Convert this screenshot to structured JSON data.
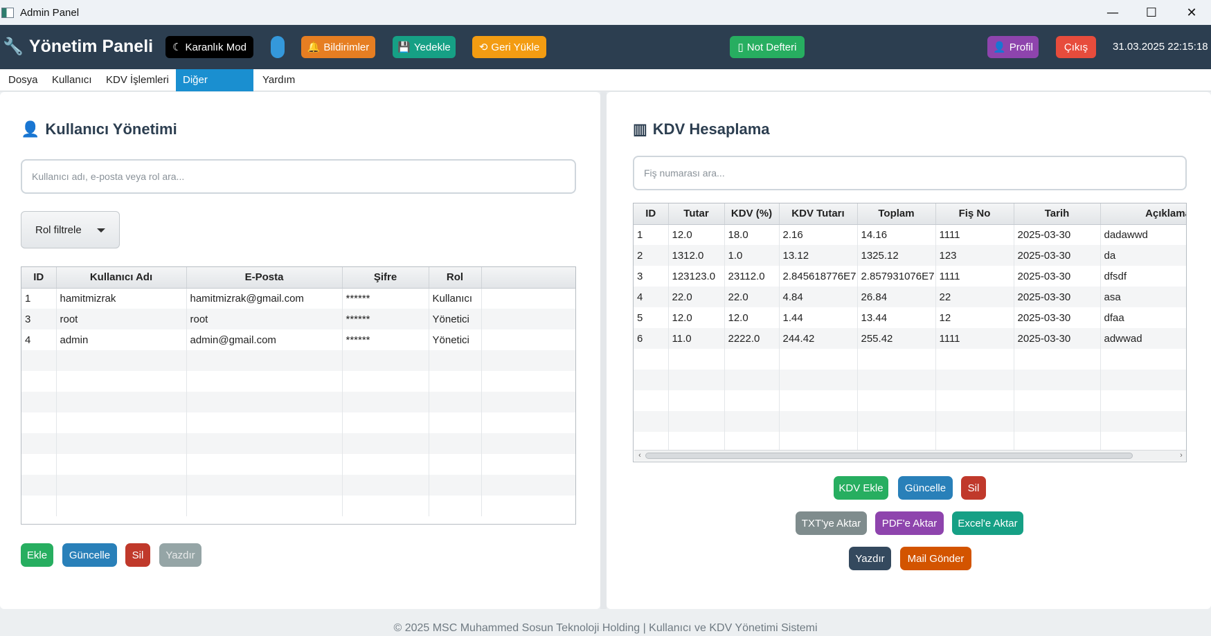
{
  "window": {
    "title": "Admin Panel",
    "controls": {
      "minimize": "—",
      "maximize": "☐",
      "close": "✕"
    }
  },
  "header": {
    "brand": "Yönetim Paneli",
    "buttons": {
      "dark_mode": "Karanlık Mod",
      "notifications": "Bildirimler",
      "backup": "Yedekle",
      "restore": "Geri Yükle",
      "notepad": "Not Defteri",
      "profile": "Profil",
      "logout": "Çıkış"
    },
    "datetime": "31.03.2025 22:15:18",
    "colors": {
      "background": "#2c3e50",
      "dark_mode": "#000000",
      "toggle": "#3498db",
      "notifications": "#e67e22",
      "backup": "#16a085",
      "restore": "#f39c12",
      "notepad": "#27ae60",
      "profile": "#8e44ad",
      "logout": "#e74c3c"
    }
  },
  "menu": {
    "items": [
      "Dosya",
      "Kullanıcı",
      "KDV İşlemleri",
      "Diğer İşlemler",
      "Yardım"
    ],
    "active": "Diğer İşlemler"
  },
  "users": {
    "title": "Kullanıcı Yönetimi",
    "search_placeholder": "Kullanıcı adı, e-posta veya rol ara...",
    "role_filter": "Rol filtrele",
    "columns": [
      "ID",
      "Kullanıcı Adı",
      "E-Posta",
      "Şifre",
      "Rol"
    ],
    "rows": [
      [
        "1",
        "hamitmizrak",
        "hamitmizrak@gmail.com",
        "******",
        "Kullanıcı"
      ],
      [
        "3",
        "root",
        "root",
        "******",
        "Yönetici"
      ],
      [
        "4",
        "admin",
        "admin@gmail.com",
        "******",
        "Yönetici"
      ]
    ],
    "buttons": {
      "add": "Ekle",
      "update": "Güncelle",
      "delete": "Sil",
      "print": "Yazdır"
    }
  },
  "kdv": {
    "title": "KDV Hesaplama",
    "search_placeholder": "Fiş numarası ara...",
    "columns": [
      "ID",
      "Tutar",
      "KDV (%)",
      "KDV Tutarı",
      "Toplam",
      "Fiş No",
      "Tarih",
      "Açıklama"
    ],
    "rows": [
      [
        "1",
        "12.0",
        "18.0",
        "2.16",
        "14.16",
        "1111",
        "2025-03-30",
        "dadawwd"
      ],
      [
        "2",
        "1312.0",
        "1.0",
        "13.12",
        "1325.12",
        "123",
        "2025-03-30",
        "da"
      ],
      [
        "3",
        "123123.0",
        "23112.0",
        "2.845618776E7",
        "2.857931076E7",
        "1111",
        "2025-03-30",
        "dfsdf"
      ],
      [
        "4",
        "22.0",
        "22.0",
        "4.84",
        "26.84",
        "22",
        "2025-03-30",
        "asa"
      ],
      [
        "5",
        "12.0",
        "12.0",
        "1.44",
        "13.44",
        "12",
        "2025-03-30",
        "dfaa"
      ],
      [
        "6",
        "11.0",
        "2222.0",
        "244.42",
        "255.42",
        "1111",
        "2025-03-30",
        "adwwad"
      ]
    ],
    "buttons": {
      "add": "KDV Ekle",
      "update": "Güncelle",
      "delete": "Sil",
      "to_txt": "TXT'ye Aktar",
      "to_pdf": "PDF'e Aktar",
      "to_excel": "Excel'e Aktar",
      "print": "Yazdır",
      "send_mail": "Mail Gönder"
    }
  },
  "footer": "© 2025 MSC Muhammed Sosun Teknoloji Holding | Kullanıcı ve KDV Yönetimi Sistemi"
}
